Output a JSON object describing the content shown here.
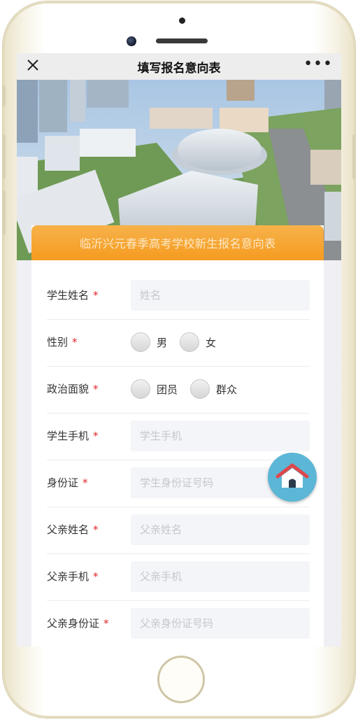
{
  "navbar": {
    "title": "填写报名意向表",
    "close_icon": "close-icon",
    "more_icon": "more-icon",
    "more_label": "•••"
  },
  "banner": {
    "image": "campus-aerial-photo",
    "form_title": "临沂兴元春季高考学校新生报名意向表"
  },
  "form": {
    "required_mark": "*",
    "fields": [
      {
        "label": "学生姓名",
        "placeholder": "姓名",
        "value": ""
      },
      {
        "label": "性别",
        "options": [
          "男",
          "女"
        ],
        "selected": null
      },
      {
        "label": "政治面貌",
        "options": [
          "团员",
          "群众"
        ],
        "selected": null
      },
      {
        "label": "学生手机",
        "placeholder": "学生手机",
        "value": ""
      },
      {
        "label": "身份证",
        "placeholder": "学生身份证号码",
        "value": ""
      },
      {
        "label": "父亲姓名",
        "placeholder": "父亲姓名",
        "value": ""
      },
      {
        "label": "父亲手机",
        "placeholder": "父亲手机",
        "value": ""
      },
      {
        "label": "父亲身份证",
        "placeholder": "父亲身份证号码",
        "value": ""
      }
    ]
  },
  "fab": {
    "icon": "home-icon"
  },
  "colors": {
    "header_orange": "#f59b20",
    "required_red": "#e0262b",
    "fab_blue": "#5cb6d6",
    "home_roof": "#e0474c"
  }
}
